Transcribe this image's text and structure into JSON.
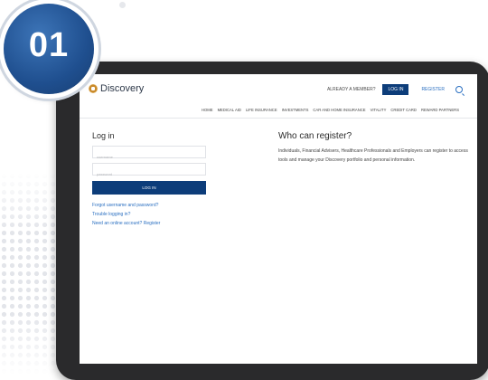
{
  "badge": {
    "number": "01"
  },
  "header": {
    "brand": "Discovery",
    "already_member": "ALREADY A MEMBER?",
    "login_button": "LOG IN",
    "register_link": "REGISTER"
  },
  "nav": {
    "items": [
      "HOME",
      "MEDICAL AID",
      "LIFE INSURANCE",
      "INVESTMENTS",
      "CAR AND HOME INSURANCE",
      "VITALITY",
      "CREDIT CARD",
      "REWARD PARTNERS"
    ]
  },
  "login": {
    "title": "Log in",
    "username_placeholder": "username",
    "password_placeholder": "password",
    "submit": "LOG IN",
    "forgot": "Forgot username and password?",
    "trouble": "Trouble logging in?",
    "need_account": "Need an online account? Register"
  },
  "register": {
    "title": "Who can register?",
    "text": "Individuals, Financial Advisers, Healthcare Professionals and Employers can register to access tools and manage your Discovery portfolio and personal information."
  },
  "colors": {
    "primary": "#0d3d7a",
    "link": "#2a6fc1",
    "badge": "#1f4f8f"
  },
  "icons": {
    "search": "search-icon",
    "brand": "discovery-logo-icon"
  }
}
